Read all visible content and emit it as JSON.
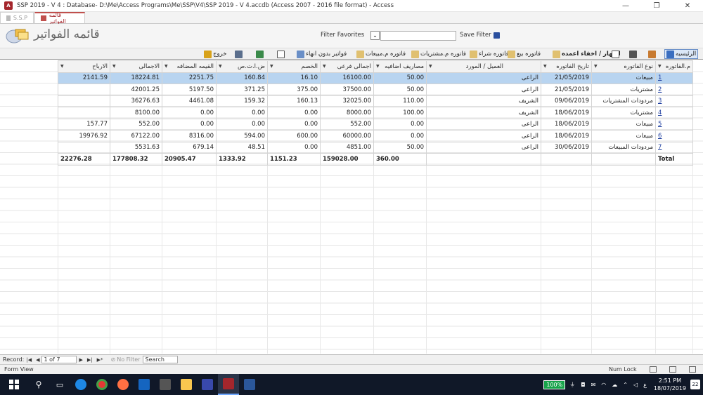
{
  "window": {
    "title": "SSP 2019 - V 4 : Database- D:\\Me\\Access Programs\\Me\\SSP\\V4\\SSP 2019 - V 4.accdb (Access 2007 - 2016 file format) - Access",
    "minimize": "—",
    "maximize": "❐",
    "close": "✕"
  },
  "tabs": [
    {
      "label": "S.S.P"
    },
    {
      "label": "قائمه الفواتير"
    }
  ],
  "header": {
    "form_title": "قائمه الفواتير",
    "filter_favorites_label": "Filter Favorites",
    "save_filter_label": "Save Filter"
  },
  "toolbar": {
    "home": "الرئيسيه",
    "show_hide_columns": "اظهار / اخفاء اعمده",
    "sales_invoice": "فاتوره بيع",
    "purchase_invoice": "فاتوره شراء",
    "purchase_returns_invoice": "فاتوره م.مشتريات",
    "sales_returns_invoice": "فاتوره م.مبيعات",
    "unfinished_invoices": "فواتير بدون انهاء",
    "exit": "خروج"
  },
  "columns": [
    "م.الفاتوره",
    "نوع الفاتوره",
    "تاريخ الفاتوره",
    "العميل / المورد",
    "مصاريف اضافيه",
    "اجمالى فرعى",
    "الخصم",
    "ض.ا.ت.ص",
    "القيمه المضافه",
    "الاجمالى",
    "الارباح"
  ],
  "rows": [
    {
      "no": "1",
      "type": "مبيعات",
      "date": "21/05/2019",
      "party": "الراعى",
      "extra": "50.00",
      "subtotal": "16100.00",
      "discount": "16.10",
      "tax": "160.84",
      "vat": "2251.75",
      "total": "18224.81",
      "profit": "2141.59"
    },
    {
      "no": "2",
      "type": "مشتريات",
      "date": "21/05/2019",
      "party": "الراعى",
      "extra": "50.00",
      "subtotal": "37500.00",
      "discount": "375.00",
      "tax": "371.25",
      "vat": "5197.50",
      "total": "42001.25",
      "profit": ""
    },
    {
      "no": "3",
      "type": "مردودات المشتريات",
      "date": "09/06/2019",
      "party": "الشريف",
      "extra": "110.00",
      "subtotal": "32025.00",
      "discount": "160.13",
      "tax": "159.32",
      "vat": "4461.08",
      "total": "36276.63",
      "profit": ""
    },
    {
      "no": "4",
      "type": "مشتريات",
      "date": "18/06/2019",
      "party": "الشريف",
      "extra": "100.00",
      "subtotal": "8000.00",
      "discount": "0.00",
      "tax": "0.00",
      "vat": "0.00",
      "total": "8100.00",
      "profit": ""
    },
    {
      "no": "5",
      "type": "مبيعات",
      "date": "18/06/2019",
      "party": "الراعى",
      "extra": "0.00",
      "subtotal": "552.00",
      "discount": "0.00",
      "tax": "0.00",
      "vat": "0.00",
      "total": "552.00",
      "profit": "157.77"
    },
    {
      "no": "6",
      "type": "مبيعات",
      "date": "18/06/2019",
      "party": "الراعى",
      "extra": "0.00",
      "subtotal": "60000.00",
      "discount": "600.00",
      "tax": "594.00",
      "vat": "8316.00",
      "total": "67122.00",
      "profit": "19976.92"
    },
    {
      "no": "7",
      "type": "مردودات المبيعات",
      "date": "30/06/2019",
      "party": "الراعى",
      "extra": "50.00",
      "subtotal": "4851.00",
      "discount": "0.00",
      "tax": "48.51",
      "vat": "679.14",
      "total": "5531.63",
      "profit": ""
    }
  ],
  "totals": {
    "label": "Total",
    "extra": "360.00",
    "subtotal": "159028.00",
    "discount": "1151.23",
    "tax": "1333.92",
    "vat": "20905.47",
    "total": "177808.32",
    "profit": "22276.28"
  },
  "record_nav": {
    "label": "Record:",
    "current": "1 of 7",
    "no_filter": "No Filter",
    "search": "Search"
  },
  "status": {
    "view": "Form View",
    "num_lock": "Num Lock"
  },
  "taskbar": {
    "battery": "100%",
    "language": "ع",
    "time": "2:51 PM",
    "date": "18/07/2019",
    "notifications": "22"
  },
  "colors": {
    "access_red": "#a4262c",
    "selection": "#b8d4f0",
    "taskbar": "#101828",
    "link": "#1f3fa0"
  }
}
